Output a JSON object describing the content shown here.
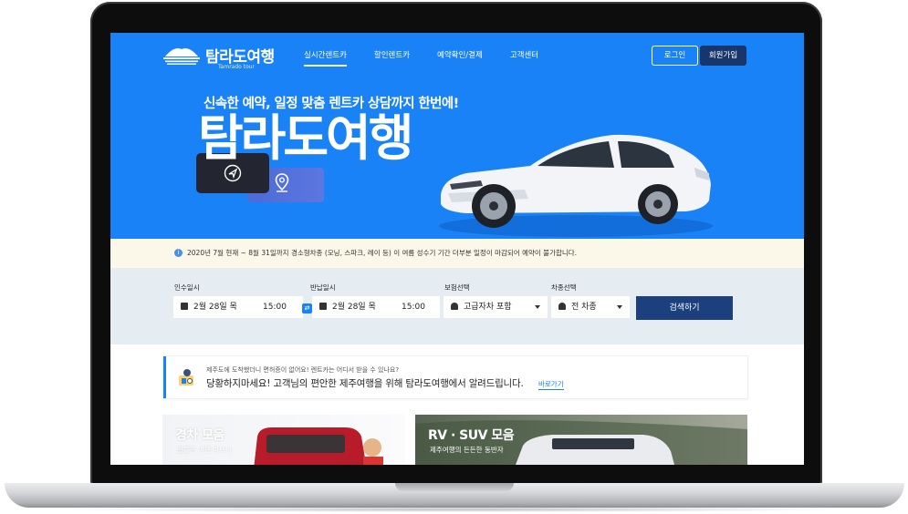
{
  "brand": {
    "name": "탐라도여행",
    "sub": "Tamrado tour"
  },
  "nav": {
    "items": [
      "실시간렌트카",
      "할인렌트카",
      "예약확인/결제",
      "고객센터"
    ],
    "active": 0
  },
  "auth": {
    "login": "로그인",
    "join": "회원가입"
  },
  "hero": {
    "subtitle": "신속한 예약, 일정 맞춤 렌트카 상담까지 한번에!",
    "title": "탐라도여행"
  },
  "notice": {
    "text": "2020년 7월 현재 ~ 8월 31일까지 경소형차종 (모닝, 스파크, 레이 등) 이 여름 성수기 기간 더부분 일정이 마감되어 예약이 불가합니다."
  },
  "search": {
    "pickup_label": "인수일시",
    "pickup_date": "2월 28일 목",
    "pickup_time": "15:00",
    "return_label": "반납일시",
    "return_date": "2월 28일 목",
    "return_time": "15:00",
    "insurance_label": "보험선택",
    "insurance_value": "고급자차 포함",
    "cartype_label": "차종선택",
    "cartype_value": "전 차종",
    "search_button": "검색하기"
  },
  "info": {
    "small": "제주도에 도착했더니 면허증이 없어요! 렌트카는 어디서 받을 수 있나요?",
    "main": "당황하지마세요! 고객님의 편안한 제주여행을 위해 탐라도여행에서 알려드립니다.",
    "link": "바로가기"
  },
  "promos": [
    {
      "title": "경차 모음",
      "sub": "알뜰한 여행 파트너"
    },
    {
      "title": "RV · SUV 모음",
      "sub": "제주여행의 든든한 동반자"
    }
  ],
  "colors": {
    "hero_blue": "#1a82f7",
    "navy": "#1c3f7e",
    "notice_bg": "#fbf8ea",
    "search_bg": "#e6edf2"
  }
}
